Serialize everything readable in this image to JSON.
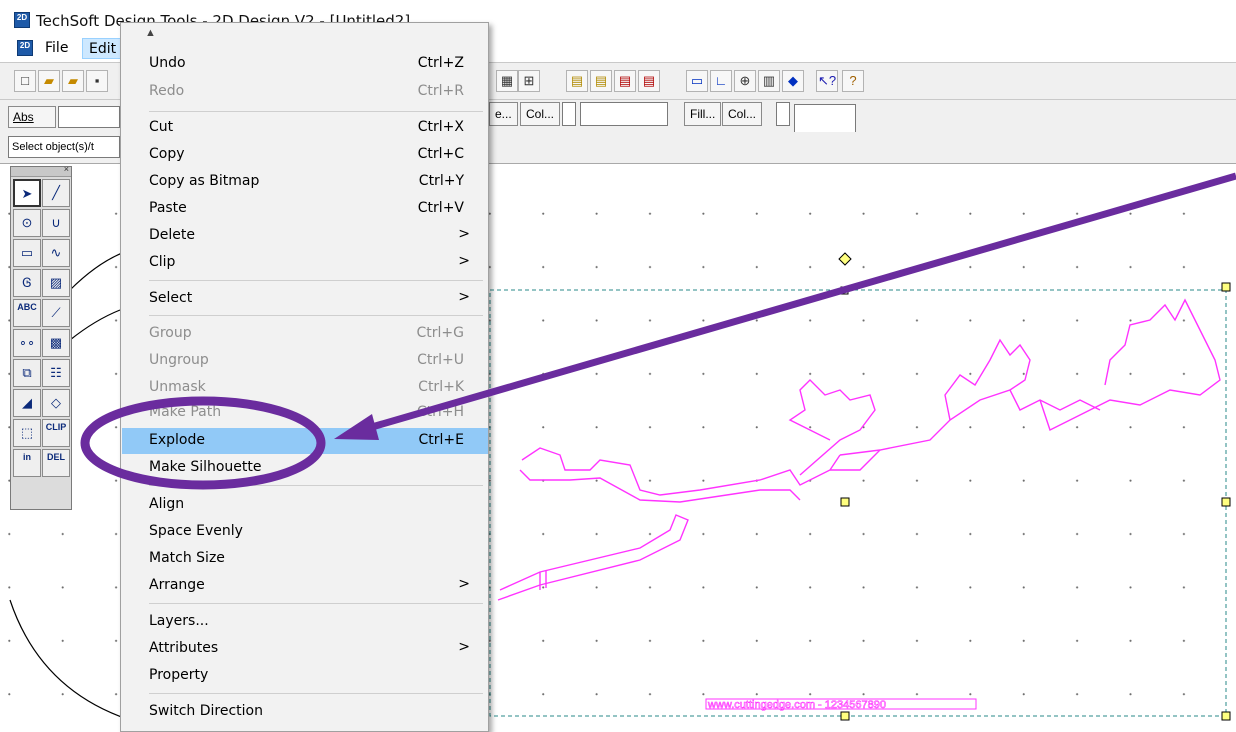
{
  "window": {
    "title": "TechSoft Design Tools - 2D Design V2 - [Untitled2]",
    "app_icon": "2D"
  },
  "menubar": {
    "items": [
      {
        "label": "File"
      },
      {
        "label": "Edit"
      }
    ]
  },
  "toolbar": {
    "icons": [
      "new-icon",
      "open-icon",
      "open-alt-icon",
      "save-icon",
      "grid-icon",
      "grid-snap-icon",
      "align-icon",
      "layer-icon",
      "layer2-icon",
      "layer3-icon",
      "layer4-icon",
      "window-icon",
      "corner-icon",
      "zoom-icon",
      "print-icon",
      "3d-icon",
      "help-pointer-icon",
      "help-icon"
    ],
    "abs_label": "Abs",
    "col_label_1": "e...",
    "col_label_2": "Col...",
    "fill_label": "Fill...",
    "col_label_3": "Col..."
  },
  "status": {
    "prompt": "Select object(s)/t"
  },
  "toolbox": {
    "tools": [
      "select-tool",
      "line-tool",
      "circle-tool",
      "arc-tool",
      "rectangle-tool",
      "curve-tool",
      "offset-tool",
      "hatch-tool",
      "text-tool",
      "dimension-tool",
      "points-tool",
      "pattern-tool",
      "copy-tool",
      "array-tool",
      "fill-tool",
      "eraser-tool",
      "box-tool",
      "clip-tool",
      "insert-tool",
      "delete-tool"
    ],
    "text_abc": "ABC",
    "text_clip": "CLIP",
    "text_in": "in",
    "text_del": "DEL"
  },
  "edit_menu": {
    "items": [
      {
        "label": "Undo",
        "shortcut": "Ctrl+Z",
        "disabled": false
      },
      {
        "label": "Redo",
        "shortcut": "Ctrl+R",
        "disabled": true
      },
      {
        "label": "Cut",
        "shortcut": "Ctrl+X",
        "disabled": false
      },
      {
        "label": "Copy",
        "shortcut": "Ctrl+C",
        "disabled": false
      },
      {
        "label": "Copy as Bitmap",
        "shortcut": "Ctrl+Y",
        "disabled": false
      },
      {
        "label": "Paste",
        "shortcut": "Ctrl+V",
        "disabled": false
      },
      {
        "label": "Delete",
        "shortcut": ">",
        "disabled": false
      },
      {
        "label": "Clip",
        "shortcut": ">",
        "disabled": false
      },
      {
        "label": "Select",
        "shortcut": ">",
        "disabled": false
      },
      {
        "label": "Group",
        "shortcut": "Ctrl+G",
        "disabled": true
      },
      {
        "label": "Ungroup",
        "shortcut": "Ctrl+U",
        "disabled": true
      },
      {
        "label": "Unmask",
        "shortcut": "Ctrl+K",
        "disabled": true
      },
      {
        "label": "Make Path",
        "shortcut": "Ctrl+H",
        "disabled": true
      },
      {
        "label": "Explode",
        "shortcut": "Ctrl+E",
        "disabled": false,
        "highlighted": true
      },
      {
        "label": "Make Silhouette",
        "shortcut": "",
        "disabled": false
      },
      {
        "label": "Align",
        "shortcut": "",
        "disabled": false
      },
      {
        "label": "Space Evenly",
        "shortcut": "",
        "disabled": false
      },
      {
        "label": "Match Size",
        "shortcut": "",
        "disabled": false
      },
      {
        "label": "Arrange",
        "shortcut": ">",
        "disabled": false
      },
      {
        "label": "Layers...",
        "shortcut": "",
        "disabled": false
      },
      {
        "label": "Attributes",
        "shortcut": ">",
        "disabled": false
      },
      {
        "label": "Property",
        "shortcut": "",
        "disabled": false
      },
      {
        "label": "Switch Direction",
        "shortcut": "",
        "disabled": false
      }
    ]
  },
  "canvas": {
    "footer_text": "www.cuttingedge.com - 1234567890"
  },
  "colors": {
    "selection": "#2a8a8a",
    "drawing": "#ff33ff",
    "annotation": "#6a2c9e",
    "menu_highlight": "#91c9f7"
  }
}
